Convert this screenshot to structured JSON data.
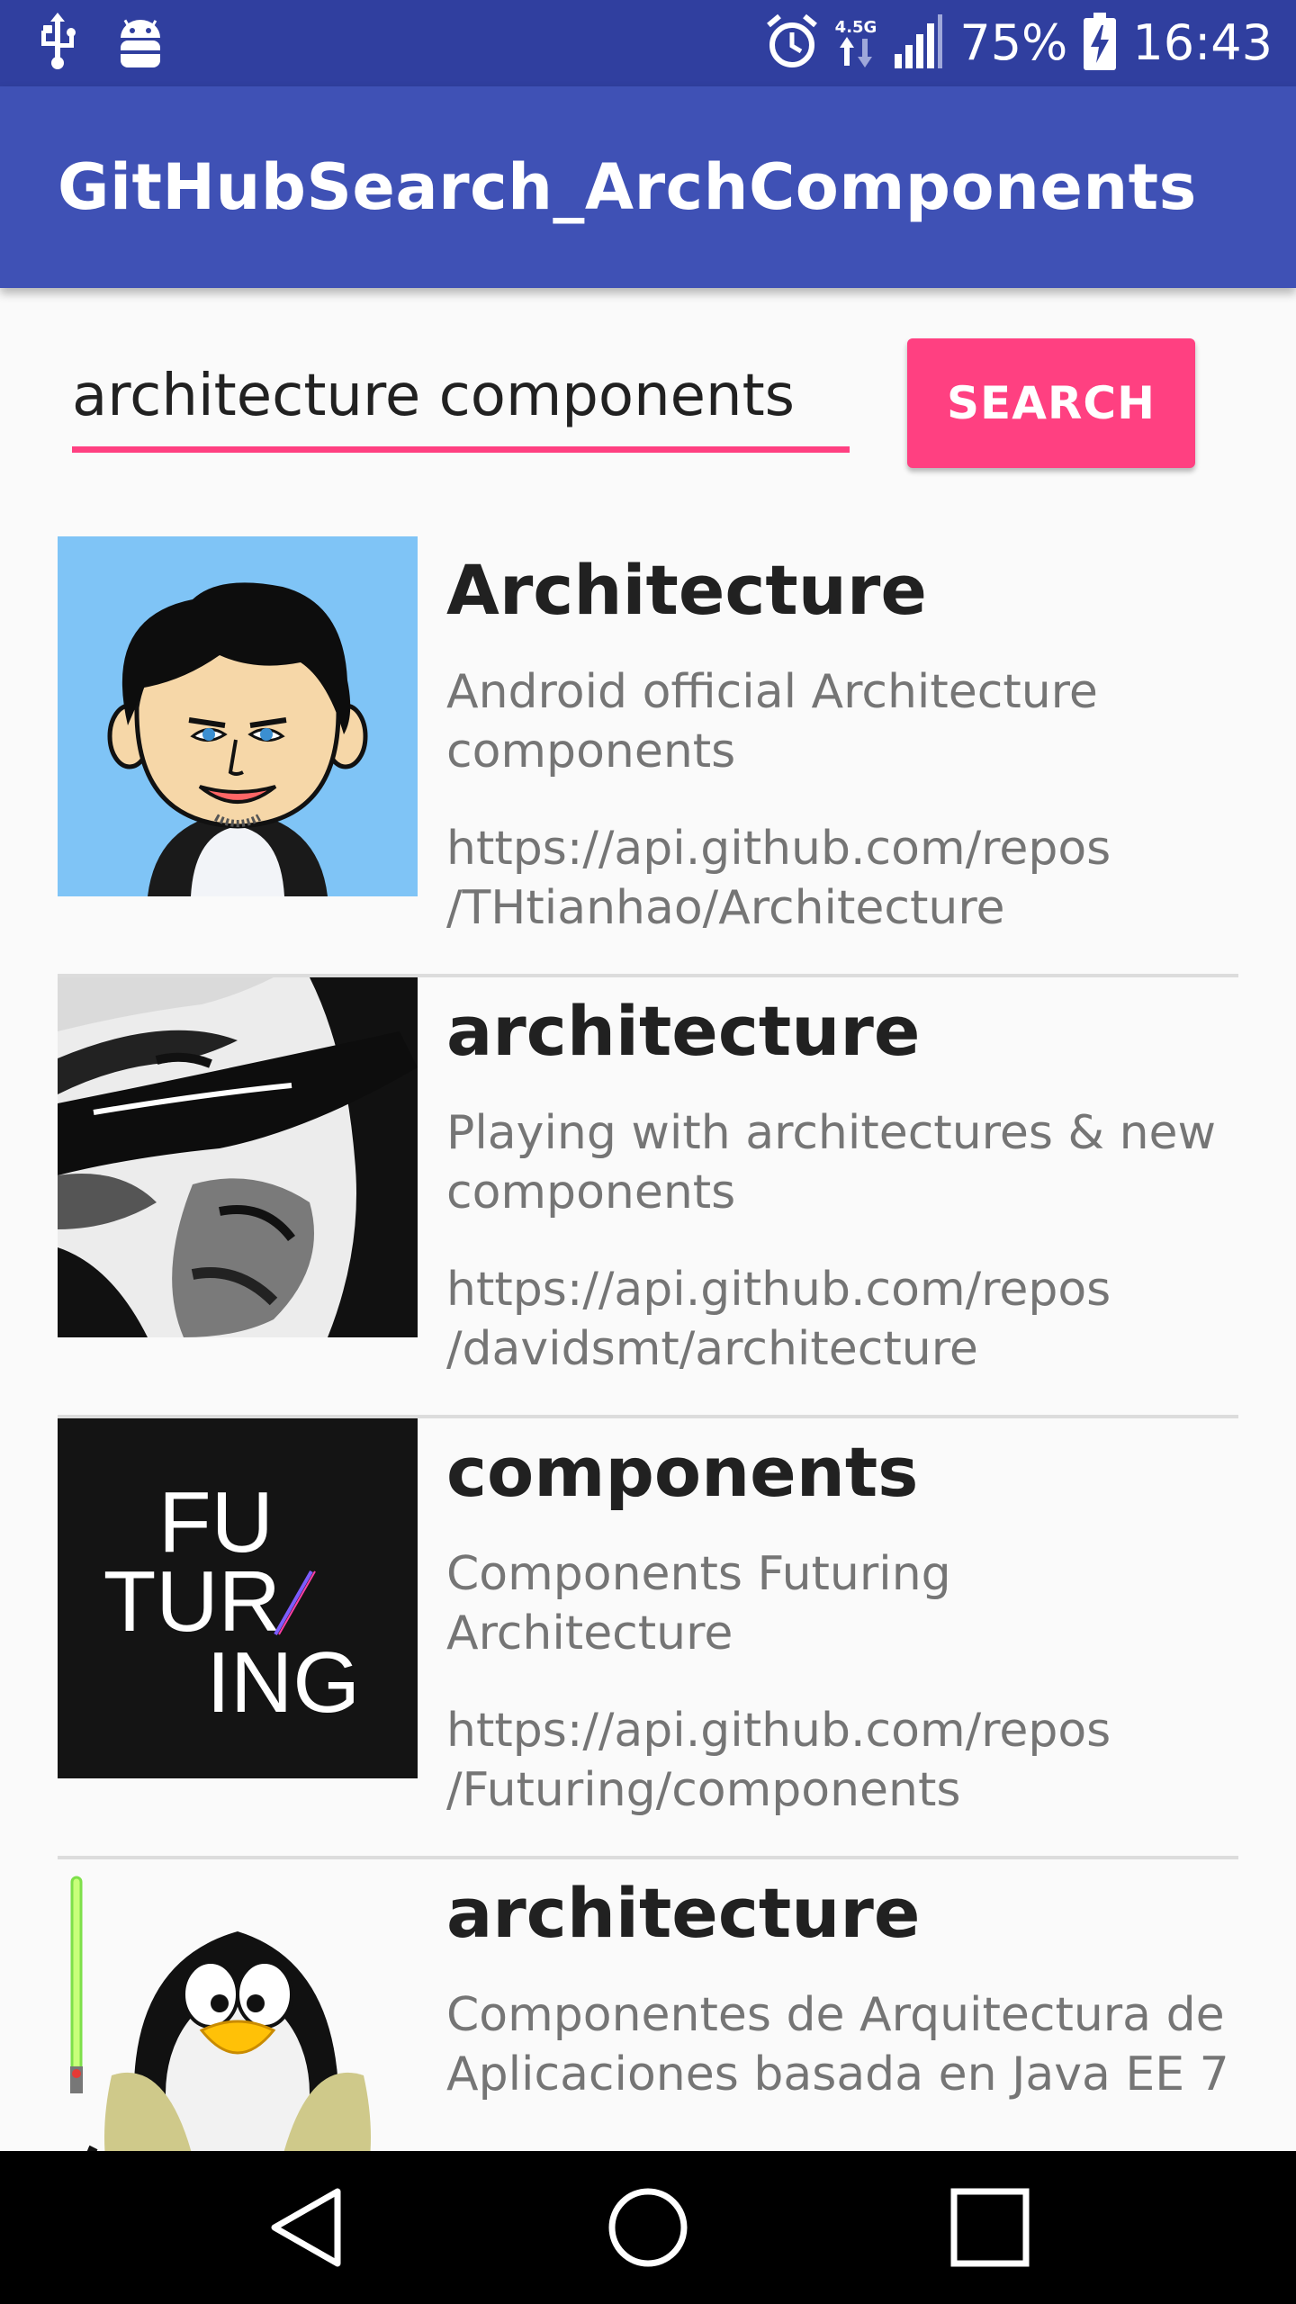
{
  "status_bar": {
    "network_type": "4.5G",
    "battery": "75%",
    "time": "16:43",
    "icons": [
      "usb-icon",
      "android-debug-icon",
      "alarm-icon",
      "network-data-icon",
      "signal-icon",
      "battery-charging-icon"
    ]
  },
  "app_bar": {
    "title": "GitHubSearch_ArchComponents"
  },
  "search": {
    "query": "architecture components",
    "button_label": "SEARCH"
  },
  "repos": [
    {
      "name": "Architecture",
      "description": "Android official Architecture\ncomponents",
      "url": "https://api.github.com/repos\n/THtianhao/Architecture"
    },
    {
      "name": "architecture",
      "description": "Playing with architectures & new\ncomponents",
      "url": "https://api.github.com/repos\n/davidsmt/architecture"
    },
    {
      "name": "components",
      "description": "Components Futuring\nArchitecture",
      "url": "https://api.github.com/repos\n/Futuring/components",
      "avatar_text": [
        "FU",
        "TUR",
        "ING"
      ]
    },
    {
      "name": "architecture",
      "description": "Componentes de Arquitectura de\nAplicaciones basada en Java EE 7",
      "url": ""
    }
  ],
  "nav_bar": {
    "buttons": [
      "back-icon",
      "home-icon",
      "recents-icon"
    ]
  },
  "colors": {
    "primary": "#3f51b5",
    "primary_dark": "#303f9f",
    "accent": "#ff4081"
  }
}
